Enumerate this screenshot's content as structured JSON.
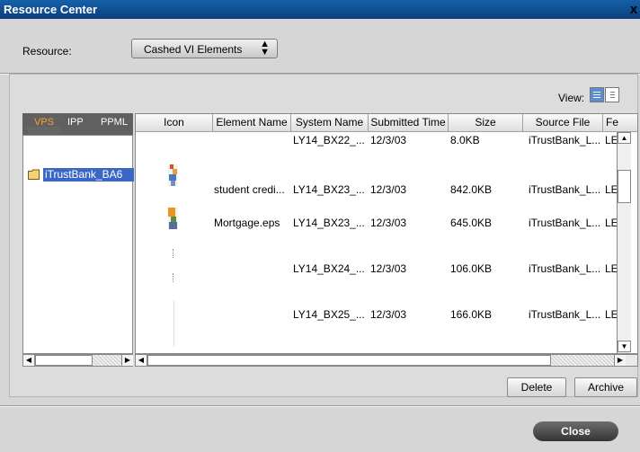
{
  "window": {
    "title": "Resource Center",
    "close_glyph": "x"
  },
  "resource": {
    "label": "Resource:",
    "selected": "Cashed VI Elements",
    "arrow": "⬍"
  },
  "view": {
    "label": "View:",
    "modes": [
      "list-view-icon",
      "thumbnail-view-icon"
    ]
  },
  "tabs": [
    {
      "label": "VPS",
      "active": true
    },
    {
      "label": "IPP"
    },
    {
      "label": "PPML"
    }
  ],
  "tree": {
    "items": [
      {
        "label": "iTrustBank_BA6"
      }
    ]
  },
  "table": {
    "columns": [
      "Icon",
      "Element Name",
      "System Name",
      "Submitted Time",
      "Size",
      "Source File",
      "Fe"
    ],
    "rows": [
      {
        "element_name": "",
        "system_name": "LY14_BX22_...",
        "submitted": "12/3/03",
        "size": "8.0KB",
        "source": "iTrustBank_L...",
        "fe": "LE"
      },
      {
        "element_name": "student credi...",
        "system_name": "LY14_BX23_...",
        "submitted": "12/3/03",
        "size": "842.0KB",
        "source": "iTrustBank_L...",
        "fe": "LE"
      },
      {
        "element_name": "Mortgage.eps",
        "system_name": "LY14_BX23_...",
        "submitted": "12/3/03",
        "size": "645.0KB",
        "source": "iTrustBank_L...",
        "fe": "LE"
      },
      {
        "element_name": "",
        "system_name": "LY14_BX24_...",
        "submitted": "12/3/03",
        "size": "106.0KB",
        "source": "iTrustBank_L...",
        "fe": "LE"
      },
      {
        "element_name": "",
        "system_name": "LY14_BX25_...",
        "submitted": "12/3/03",
        "size": "166.0KB",
        "source": "iTrustBank_L...",
        "fe": "LE"
      }
    ]
  },
  "buttons": {
    "delete": "Delete",
    "archive": "Archive",
    "close": "Close"
  },
  "colors": {
    "title_bar": "#0a3f7e",
    "selection": "#3a67c4",
    "active_tab": "#f5a623"
  }
}
